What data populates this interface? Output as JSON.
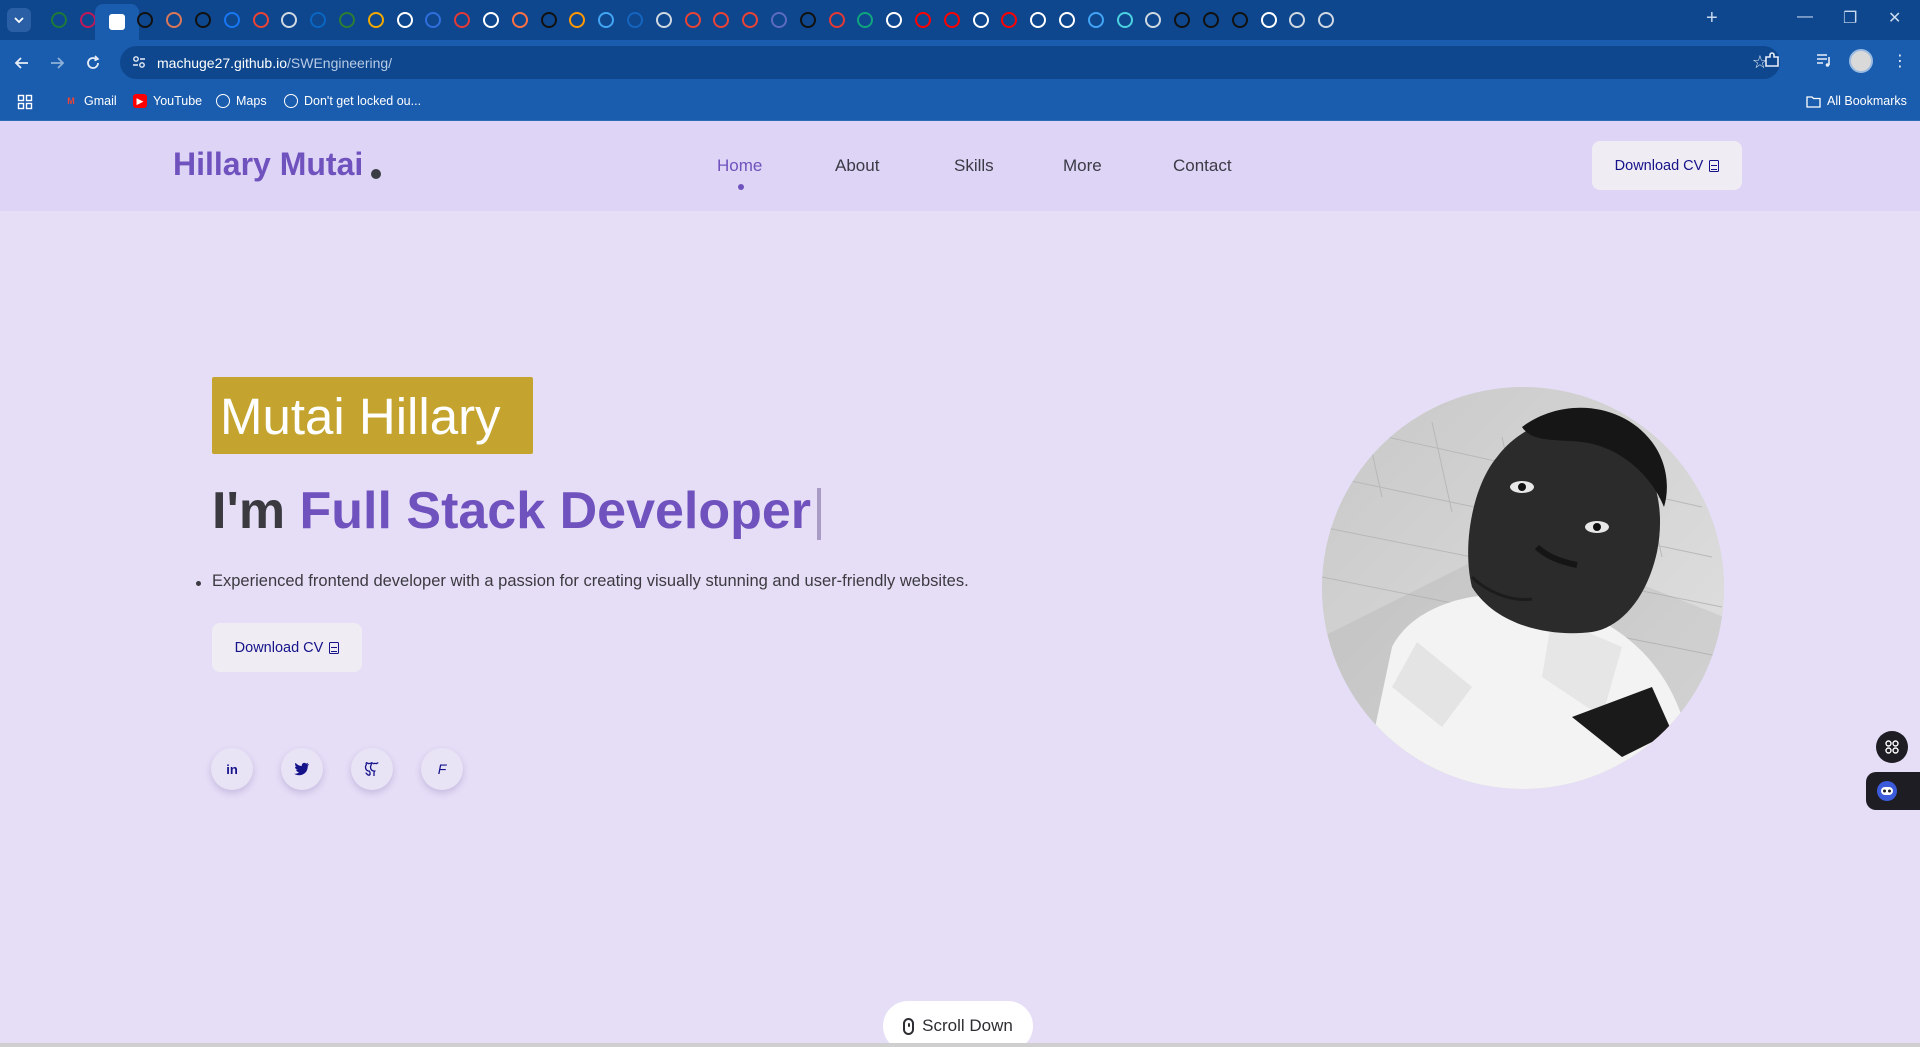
{
  "browser": {
    "url_domain": "machuge27.github.io",
    "url_path": "/SWEngineering/",
    "tabs": [
      {
        "icon": "site-icon",
        "color": "#1e7a3a"
      },
      {
        "icon": "site-icon",
        "color": "#c2185b"
      },
      {
        "icon": "portfolio-icon",
        "color": "#ffffff",
        "active": true
      },
      {
        "icon": "site-icon",
        "color": "#111111"
      },
      {
        "icon": "claude-icon",
        "color": "#d97757"
      },
      {
        "icon": "chatgpt-icon",
        "color": "#111111"
      },
      {
        "icon": "facebook-icon",
        "color": "#1877f2"
      },
      {
        "icon": "gmail-icon",
        "color": "#ea4335"
      },
      {
        "icon": "globe-icon",
        "color": "#cfd8e3"
      },
      {
        "icon": "linkedin-icon",
        "color": "#0a66c2"
      },
      {
        "icon": "site-icon",
        "color": "#2e7d32"
      },
      {
        "icon": "site-icon",
        "color": "#f2a900"
      },
      {
        "icon": "github-icon",
        "color": "#ffffff"
      },
      {
        "icon": "site-icon",
        "color": "#2f6fde"
      },
      {
        "icon": "site-icon",
        "color": "#e53935"
      },
      {
        "icon": "chatgpt-icon",
        "color": "#ffffff"
      },
      {
        "icon": "site-icon",
        "color": "#ff7043"
      },
      {
        "icon": "site-icon",
        "color": "#111111"
      },
      {
        "icon": "site-icon",
        "color": "#ff9800"
      },
      {
        "icon": "site-icon",
        "color": "#42a5f5"
      },
      {
        "icon": "site-icon",
        "color": "#1565c0"
      },
      {
        "icon": "audio-icon",
        "color": "#cfd8e3"
      },
      {
        "icon": "gmail-icon",
        "color": "#ea4335"
      },
      {
        "icon": "gmail-icon",
        "color": "#ea4335"
      },
      {
        "icon": "gmail-icon",
        "color": "#ea4335"
      },
      {
        "icon": "site-icon",
        "color": "#5c6bc0"
      },
      {
        "icon": "chatgpt-icon",
        "color": "#111111"
      },
      {
        "icon": "site-icon",
        "color": "#e53935"
      },
      {
        "icon": "site-icon",
        "color": "#10a37f"
      },
      {
        "icon": "chatgpt-icon",
        "color": "#ffffff"
      },
      {
        "icon": "youtube-icon",
        "color": "#ff0000"
      },
      {
        "icon": "youtube-icon",
        "color": "#ff0000"
      },
      {
        "icon": "site-icon",
        "color": "#ffffff"
      },
      {
        "icon": "youtube-icon",
        "color": "#ff0000"
      },
      {
        "icon": "site-icon",
        "color": "#ffffff"
      },
      {
        "icon": "google-icon",
        "color": "#ffffff"
      },
      {
        "icon": "site-icon",
        "color": "#42a5f5"
      },
      {
        "icon": "site-icon",
        "color": "#4dd0e1"
      },
      {
        "icon": "globe-icon",
        "color": "#cfd8e3"
      },
      {
        "icon": "chatgpt-icon",
        "color": "#111111"
      },
      {
        "icon": "chatgpt-icon",
        "color": "#111111"
      },
      {
        "icon": "chatgpt-icon",
        "color": "#111111"
      },
      {
        "icon": "github-icon",
        "color": "#ffffff"
      },
      {
        "icon": "globe-icon",
        "color": "#cfd8e3"
      },
      {
        "icon": "globe-icon",
        "color": "#cfd8e3"
      }
    ],
    "bookmarks": [
      {
        "label": "Gmail",
        "icon": "gmail-icon"
      },
      {
        "label": "YouTube",
        "icon": "youtube-icon"
      },
      {
        "label": "Maps",
        "icon": "maps-icon"
      },
      {
        "label": "Don't get locked ou...",
        "icon": "globe-icon"
      }
    ],
    "all_bookmarks_label": "All Bookmarks"
  },
  "site": {
    "logo": "Hillary Mutai",
    "nav": [
      {
        "label": "Home",
        "active": true
      },
      {
        "label": "About"
      },
      {
        "label": "Skills"
      },
      {
        "label": "More"
      },
      {
        "label": "Contact"
      }
    ],
    "header_cv_label": "Download CV"
  },
  "hero": {
    "name": "Mutai Hillary",
    "role_prefix": "I'm",
    "role": "Full Stack Developer",
    "description": "Experienced frontend developer with a passion for creating visually stunning and user-friendly websites.",
    "cv_label": "Download CV",
    "socials": [
      {
        "icon": "linkedin-icon",
        "glyph": "in"
      },
      {
        "icon": "twitter-icon",
        "glyph": "🐦"
      },
      {
        "icon": "github-icon",
        "glyph": "⌂"
      },
      {
        "icon": "facebook-icon",
        "glyph": "F"
      }
    ]
  },
  "scroll_down_label": "Scroll Down",
  "colors": {
    "accent": "#6f52bd",
    "highlight": "#c4a42e",
    "background": "#e6def7",
    "browser_frame": "#1a5cae"
  }
}
